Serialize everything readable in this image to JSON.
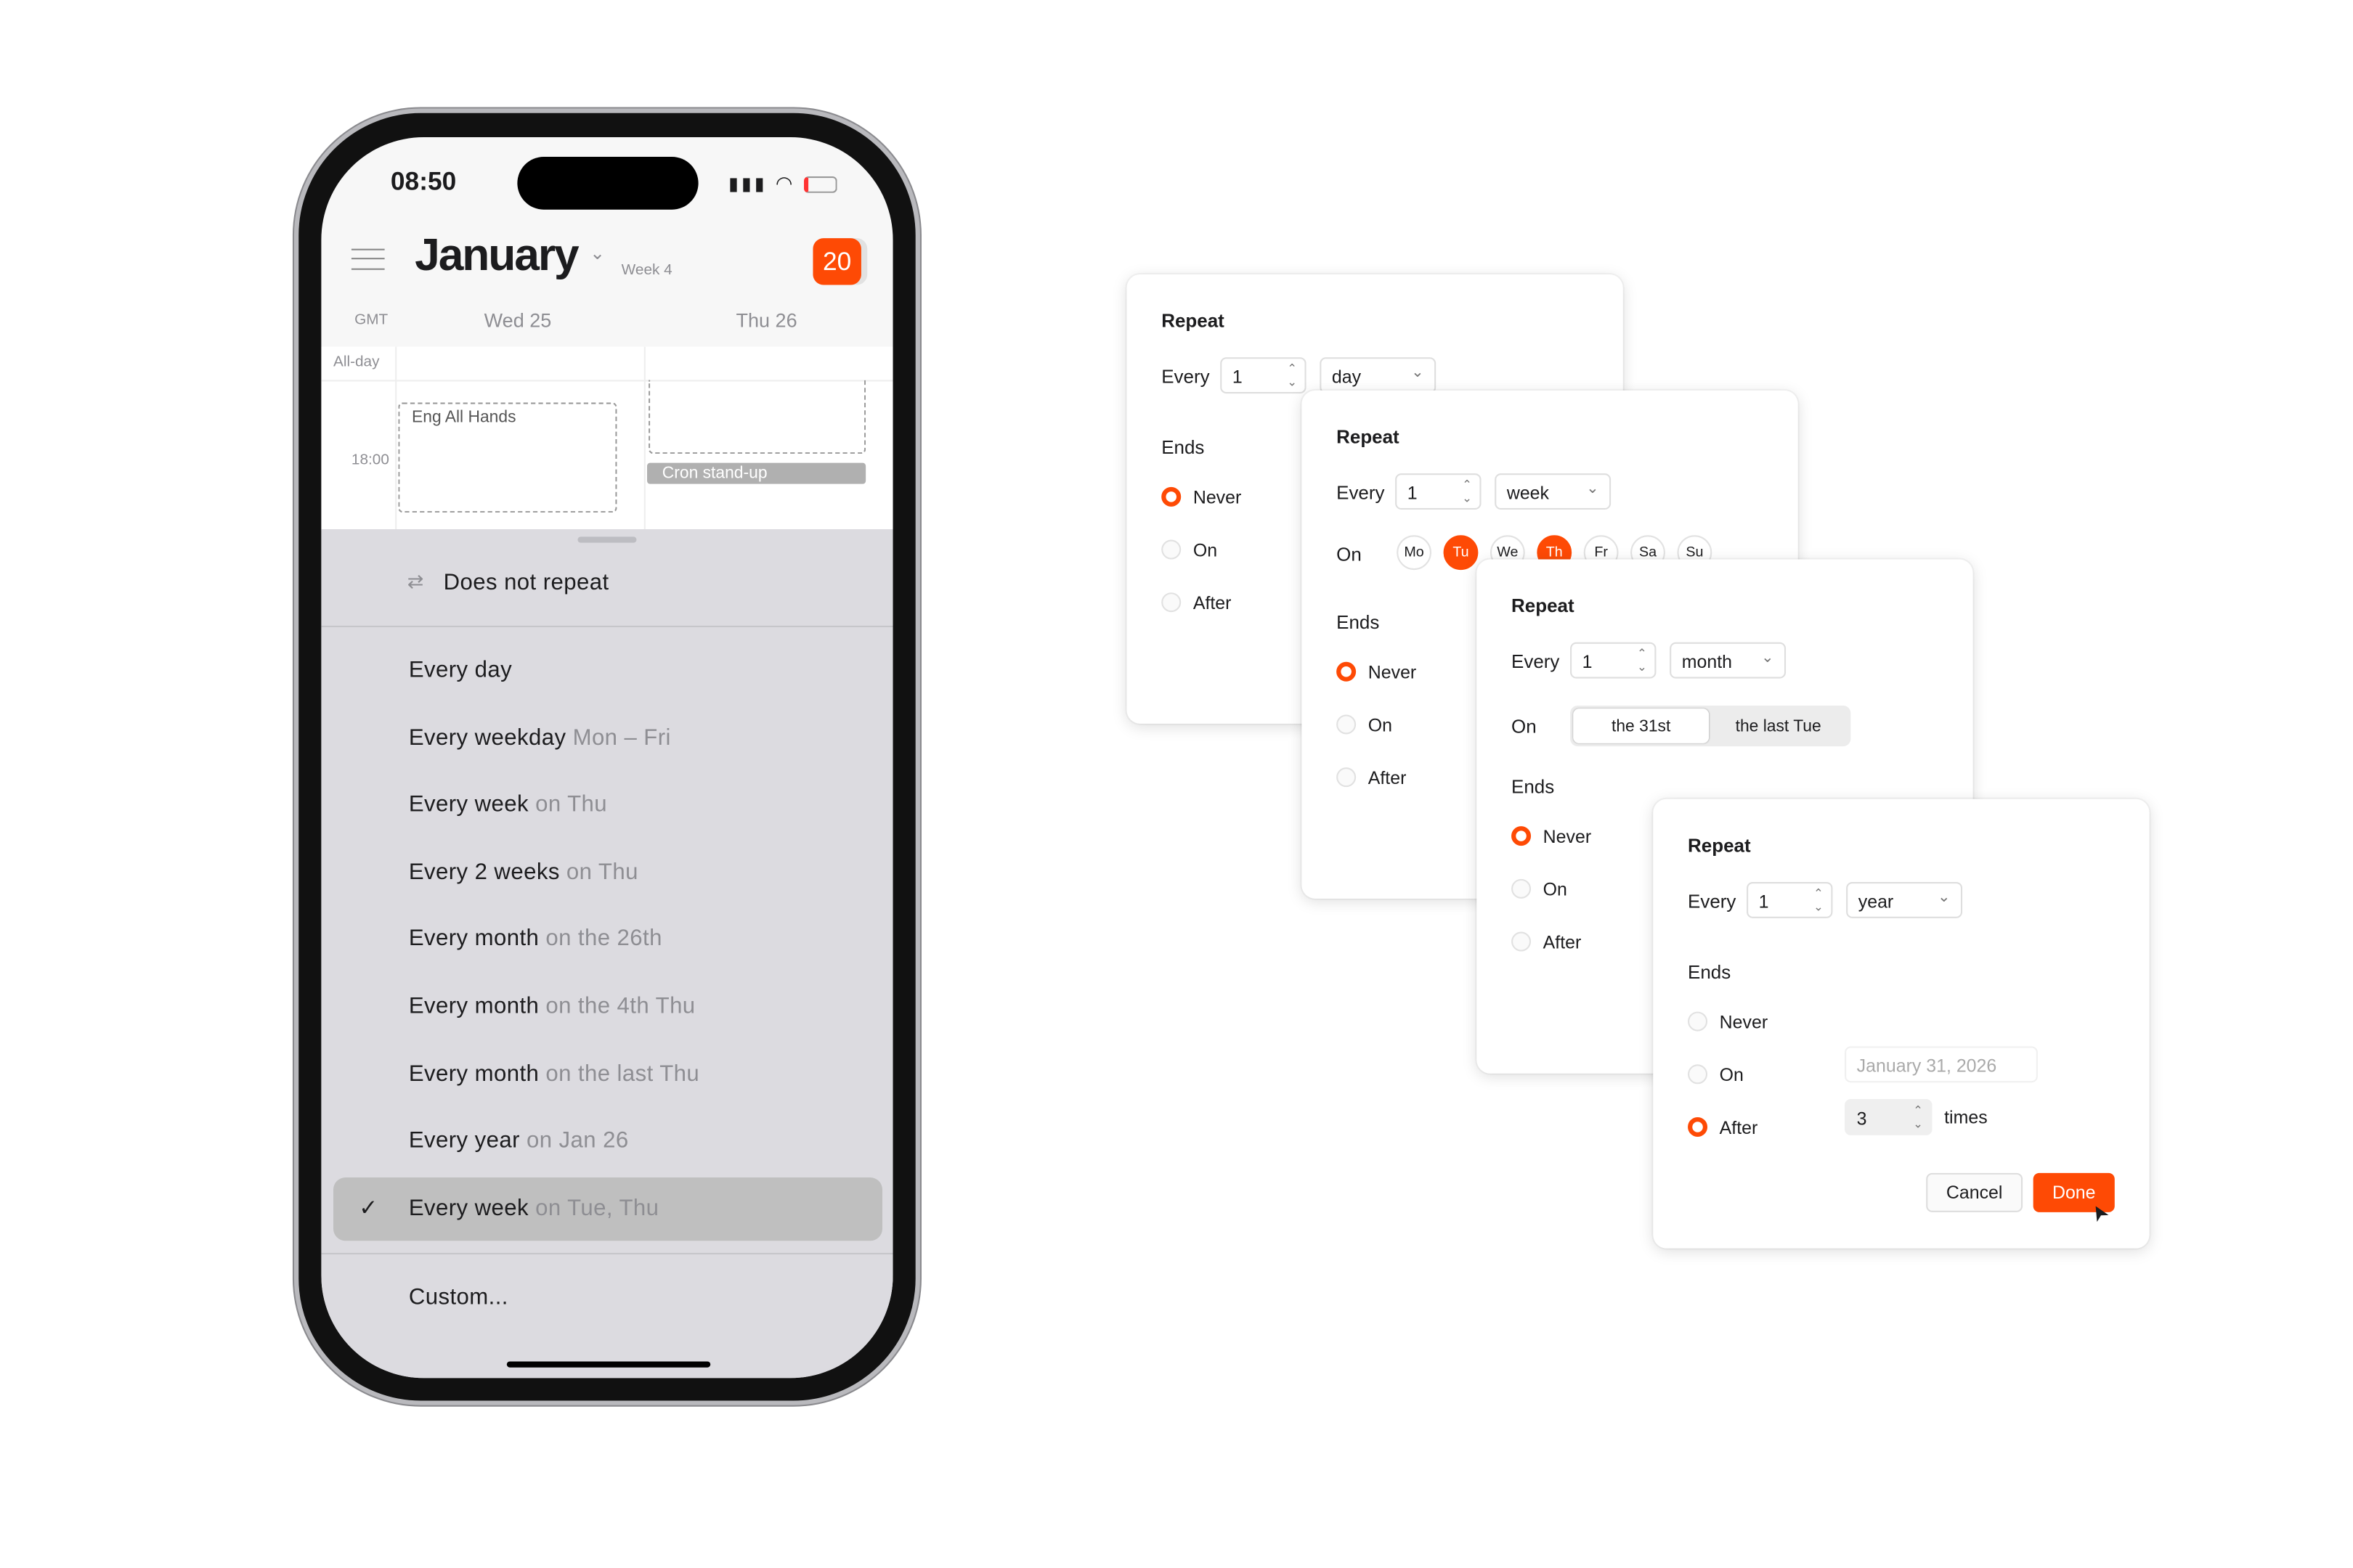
{
  "accent_color": "#fe4a05",
  "phone": {
    "status": {
      "time": "08:50",
      "icons": [
        "signal-icon",
        "wifi-icon",
        "battery-charging-icon"
      ]
    },
    "header": {
      "month": "January",
      "week": "Week 4",
      "today_badge": "20"
    },
    "columns": {
      "timezone": "GMT",
      "days": [
        "Wed 25",
        "Thu 26"
      ]
    },
    "allday_label": "All-day",
    "time_label": "18:00",
    "events": [
      "Eng All Hands",
      "Cron stand-up"
    ],
    "sheet": {
      "no_repeat": "Does not repeat",
      "items": [
        {
          "main": "Every day",
          "sub": ""
        },
        {
          "main": "Every weekday",
          "sub": "Mon – Fri"
        },
        {
          "main": "Every week",
          "sub": "on Thu"
        },
        {
          "main": "Every 2 weeks",
          "sub": "on Thu"
        },
        {
          "main": "Every month",
          "sub": "on the 26th"
        },
        {
          "main": "Every month",
          "sub": "on the 4th Thu"
        },
        {
          "main": "Every month",
          "sub": "on the last Thu"
        },
        {
          "main": "Every year",
          "sub": "on Jan 26"
        }
      ],
      "selected": {
        "main": "Every week",
        "sub": "on Tue, Thu"
      },
      "custom": "Custom..."
    }
  },
  "cards": [
    {
      "title": "Repeat",
      "every_label": "Every",
      "every_value": "1",
      "unit": "day",
      "ends_label": "Ends",
      "ends": [
        "Never",
        "On",
        "After"
      ],
      "ends_selected": "Never"
    },
    {
      "title": "Repeat",
      "every_label": "Every",
      "every_value": "1",
      "unit": "week",
      "on_label": "On",
      "days": [
        "Mo",
        "Tu",
        "We",
        "Th",
        "Fr",
        "Sa",
        "Su"
      ],
      "days_selected": [
        "Tu",
        "Th"
      ],
      "ends_label": "Ends",
      "ends": [
        "Never",
        "On",
        "After"
      ],
      "ends_selected": "Never"
    },
    {
      "title": "Repeat",
      "every_label": "Every",
      "every_value": "1",
      "unit": "month",
      "on_label": "On",
      "segments": [
        "the 31st",
        "the last Tue"
      ],
      "segment_selected": "the 31st",
      "ends_label": "Ends",
      "ends": [
        "Never",
        "On",
        "After"
      ],
      "ends_selected": "Never"
    },
    {
      "title": "Repeat",
      "every_label": "Every",
      "every_value": "1",
      "unit": "year",
      "ends_label": "Ends",
      "ends": [
        "Never",
        "On",
        "After"
      ],
      "ends_selected": "After",
      "on_date_placeholder": "January 31, 2026",
      "after_count": "3",
      "times_label": "times",
      "cancel": "Cancel",
      "done": "Done"
    }
  ]
}
